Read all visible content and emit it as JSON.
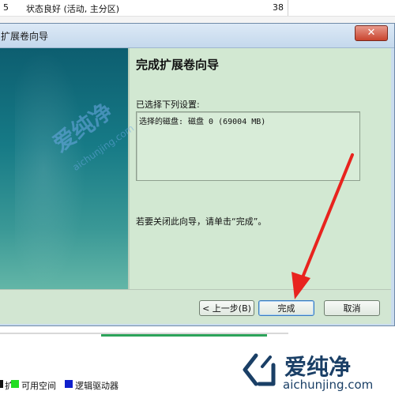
{
  "background_row": {
    "col_a": "5",
    "status": "状态良好 (活动, 主分区)",
    "number": "38"
  },
  "window": {
    "title": "扩展卷向导",
    "close_glyph": "✕"
  },
  "page": {
    "heading": "完成扩展卷向导",
    "selected_label": "已选择下列设置:",
    "settings": [
      "选择的磁盘: 磁盘 0 (69004 MB)"
    ],
    "close_hint": "若要关闭此向导，请单击“完成”。"
  },
  "buttons": {
    "back": "< 上一步(B)",
    "finish": "完成",
    "cancel": "取消"
  },
  "legend": {
    "item1": "扩",
    "item2": "可用空间",
    "item3": "逻辑驱动器"
  },
  "watermark": {
    "diag_text": "爱纯净",
    "diag_url": "aichunjing.com",
    "brand": "爱纯净",
    "url": "aichunjing.com"
  },
  "colors": {
    "arrow": "#e8231e",
    "accent_blue": "#1a3f66"
  }
}
